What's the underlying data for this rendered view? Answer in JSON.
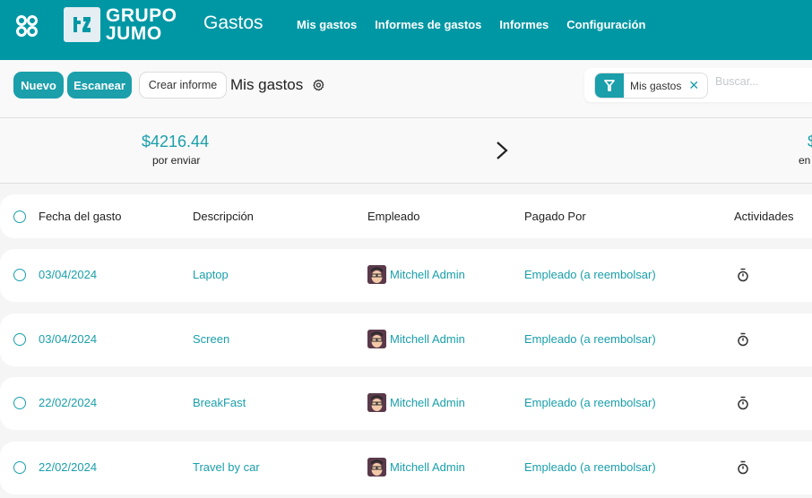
{
  "navbar": {
    "brand_line1": "GRUPO",
    "brand_line2": "JUMO",
    "app_title": "Gastos",
    "menu": [
      {
        "label": "Mis gastos"
      },
      {
        "label": "Informes de gastos"
      },
      {
        "label": "Informes"
      },
      {
        "label": "Configuración"
      }
    ],
    "accent_color": "#0097a5"
  },
  "control_panel": {
    "new_label": "Nuevo",
    "scan_label": "Escanear",
    "create_report_label": "Crear informe",
    "page_title": "Mis gastos",
    "filter_facet": "Mis gastos",
    "search_placeholder": "Buscar..."
  },
  "summary": [
    {
      "amount": "$4216.44",
      "label": "por enviar"
    },
    {
      "amount": "$",
      "label": "en"
    }
  ],
  "table": {
    "headers": {
      "date": "Fecha del gasto",
      "description": "Descripción",
      "employee": "Empleado",
      "paid_by": "Pagado Por",
      "activities": "Actividades"
    },
    "rows": [
      {
        "date": "03/04/2024",
        "description": "Laptop",
        "employee": "Mitchell Admin",
        "paid_by": "Empleado (a reembolsar)"
      },
      {
        "date": "03/04/2024",
        "description": "Screen",
        "employee": "Mitchell Admin",
        "paid_by": "Empleado (a reembolsar)"
      },
      {
        "date": "22/02/2024",
        "description": "BreakFast",
        "employee": "Mitchell Admin",
        "paid_by": "Empleado (a reembolsar)"
      },
      {
        "date": "22/02/2024",
        "description": "Travel by car",
        "employee": "Mitchell Admin",
        "paid_by": "Empleado (a reembolsar)"
      }
    ]
  }
}
